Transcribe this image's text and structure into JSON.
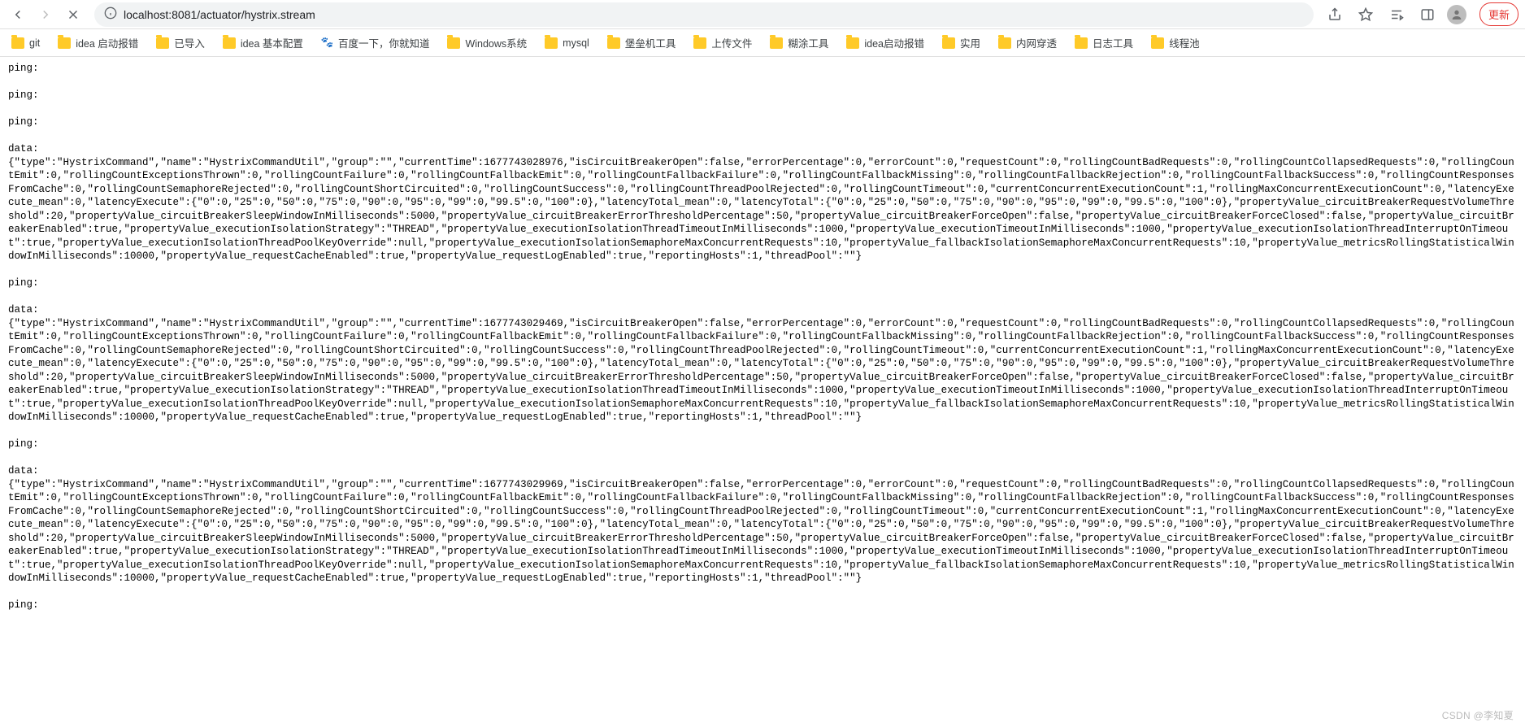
{
  "toolbar": {
    "url": "localhost:8081/actuator/hystrix.stream",
    "update_label": "更新"
  },
  "bookmarks": [
    {
      "label": "git",
      "type": "folder"
    },
    {
      "label": "idea 启动报错",
      "type": "folder"
    },
    {
      "label": "已导入",
      "type": "folder"
    },
    {
      "label": "idea 基本配置",
      "type": "folder"
    },
    {
      "label": "百度一下，你就知道",
      "type": "baidu"
    },
    {
      "label": "Windows系统",
      "type": "folder"
    },
    {
      "label": "mysql",
      "type": "folder"
    },
    {
      "label": "堡垒机工具",
      "type": "folder"
    },
    {
      "label": "上传文件",
      "type": "folder"
    },
    {
      "label": "糊涂工具",
      "type": "folder"
    },
    {
      "label": "idea启动报错",
      "type": "folder"
    },
    {
      "label": "实用",
      "type": "folder"
    },
    {
      "label": "内网穿透",
      "type": "folder"
    },
    {
      "label": "日志工具",
      "type": "folder"
    },
    {
      "label": "线程池",
      "type": "folder"
    }
  ],
  "stream": {
    "ping_label": "ping:",
    "data_label": "data:",
    "events": [
      {
        "kind": "ping"
      },
      {
        "kind": "ping"
      },
      {
        "kind": "ping"
      },
      {
        "kind": "data",
        "currentTime": 1677743028976
      },
      {
        "kind": "ping"
      },
      {
        "kind": "data",
        "currentTime": 1677743029469
      },
      {
        "kind": "ping"
      },
      {
        "kind": "data",
        "currentTime": 1677743029969
      },
      {
        "kind": "ping"
      }
    ],
    "data_template": "{\"type\":\"HystrixCommand\",\"name\":\"HystrixCommandUtil\",\"group\":\"\",\"currentTime\":__TIME__,\"isCircuitBreakerOpen\":false,\"errorPercentage\":0,\"errorCount\":0,\"requestCount\":0,\"rollingCountBadRequests\":0,\"rollingCountCollapsedRequests\":0,\"rollingCountEmit\":0,\"rollingCountExceptionsThrown\":0,\"rollingCountFailure\":0,\"rollingCountFallbackEmit\":0,\"rollingCountFallbackFailure\":0,\"rollingCountFallbackMissing\":0,\"rollingCountFallbackRejection\":0,\"rollingCountFallbackSuccess\":0,\"rollingCountResponsesFromCache\":0,\"rollingCountSemaphoreRejected\":0,\"rollingCountShortCircuited\":0,\"rollingCountSuccess\":0,\"rollingCountThreadPoolRejected\":0,\"rollingCountTimeout\":0,\"currentConcurrentExecutionCount\":1,\"rollingMaxConcurrentExecutionCount\":0,\"latencyExecute_mean\":0,\"latencyExecute\":{\"0\":0,\"25\":0,\"50\":0,\"75\":0,\"90\":0,\"95\":0,\"99\":0,\"99.5\":0,\"100\":0},\"latencyTotal_mean\":0,\"latencyTotal\":{\"0\":0,\"25\":0,\"50\":0,\"75\":0,\"90\":0,\"95\":0,\"99\":0,\"99.5\":0,\"100\":0},\"propertyValue_circuitBreakerRequestVolumeThreshold\":20,\"propertyValue_circuitBreakerSleepWindowInMilliseconds\":5000,\"propertyValue_circuitBreakerErrorThresholdPercentage\":50,\"propertyValue_circuitBreakerForceOpen\":false,\"propertyValue_circuitBreakerForceClosed\":false,\"propertyValue_circuitBreakerEnabled\":true,\"propertyValue_executionIsolationStrategy\":\"THREAD\",\"propertyValue_executionIsolationThreadTimeoutInMilliseconds\":1000,\"propertyValue_executionTimeoutInMilliseconds\":1000,\"propertyValue_executionIsolationThreadInterruptOnTimeout\":true,\"propertyValue_executionIsolationThreadPoolKeyOverride\":null,\"propertyValue_executionIsolationSemaphoreMaxConcurrentRequests\":10,\"propertyValue_fallbackIsolationSemaphoreMaxConcurrentRequests\":10,\"propertyValue_metricsRollingStatisticalWindowInMilliseconds\":10000,\"propertyValue_requestCacheEnabled\":true,\"propertyValue_requestLogEnabled\":true,\"reportingHosts\":1,\"threadPool\":\"\"}"
  },
  "watermark": "CSDN @李知夏"
}
